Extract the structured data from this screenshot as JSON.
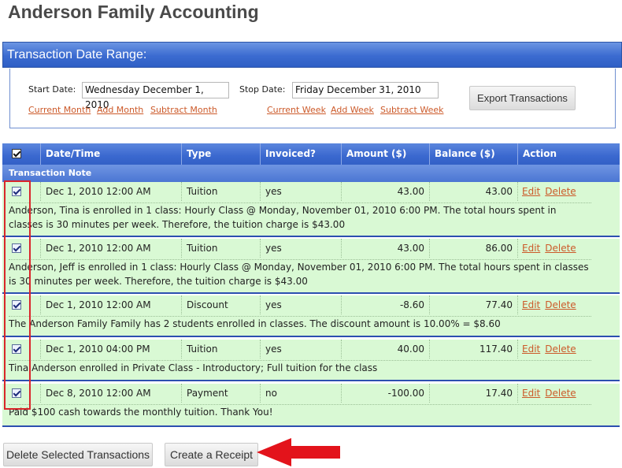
{
  "page_title": "Anderson Family Accounting",
  "date_range": {
    "header": "Transaction Date Range:",
    "start_label": "Start Date:",
    "start_value": "Wednesday December 1, 2010",
    "stop_label": "Stop Date:",
    "stop_value": "Friday December 31, 2010",
    "month_links": [
      "Current Month",
      "Add Month",
      "Subtract Month"
    ],
    "week_links": [
      "Current Week",
      "Add Week",
      "Subtract Week"
    ],
    "export_label": "Export Transactions"
  },
  "grid": {
    "columns": [
      "Date/Time",
      "Type",
      "Invoiced?",
      "Amount ($)",
      "Balance ($)",
      "Action"
    ],
    "note_header": "Transaction Note",
    "edit_label": "Edit",
    "delete_label": "Delete",
    "rows": [
      {
        "date": "Dec 1, 2010 12:00 AM",
        "type": "Tuition",
        "invoiced": "yes",
        "amount": "43.00",
        "balance": "43.00",
        "checked": true,
        "note": "Anderson, Tina is enrolled in 1 class: Hourly Class @ Monday, November 01, 2010 6:00 PM. The total hours spent in classes is 30 minutes per week. Therefore, the tuition charge is $43.00"
      },
      {
        "date": "Dec 1, 2010 12:00 AM",
        "type": "Tuition",
        "invoiced": "yes",
        "amount": "43.00",
        "balance": "86.00",
        "checked": true,
        "note": "Anderson, Jeff is enrolled in 1 class: Hourly Class @ Monday, November 01, 2010 6:00 PM. The total hours spent in classes is 30 minutes per week. Therefore, the tuition charge is $43.00"
      },
      {
        "date": "Dec 1, 2010 12:00 AM",
        "type": "Discount",
        "invoiced": "yes",
        "amount": "-8.60",
        "balance": "77.40",
        "checked": true,
        "note": "The Anderson Family Family has 2 students enrolled in classes. The discount amount is 10.00% = $8.60"
      },
      {
        "date": "Dec 1, 2010 04:00 PM",
        "type": "Tuition",
        "invoiced": "yes",
        "amount": "40.00",
        "balance": "117.40",
        "checked": true,
        "note": "Tina Anderson enrolled in Private Class - Introductory; Full tuition for the class"
      },
      {
        "date": "Dec 8, 2010 12:00 AM",
        "type": "Payment",
        "invoiced": "no",
        "amount": "-100.00",
        "balance": "17.40",
        "checked": true,
        "note": "Paid $100 cash towards the monthly tuition. Thank You!"
      }
    ]
  },
  "actions": {
    "delete_selected": "Delete Selected Transactions",
    "create_receipt": "Create a Receipt"
  },
  "colors": {
    "header_blue": "#3a68cf",
    "row_green": "#d9f9d4",
    "link_orange": "#cc5a2a",
    "annotation_red": "#d9262b"
  }
}
